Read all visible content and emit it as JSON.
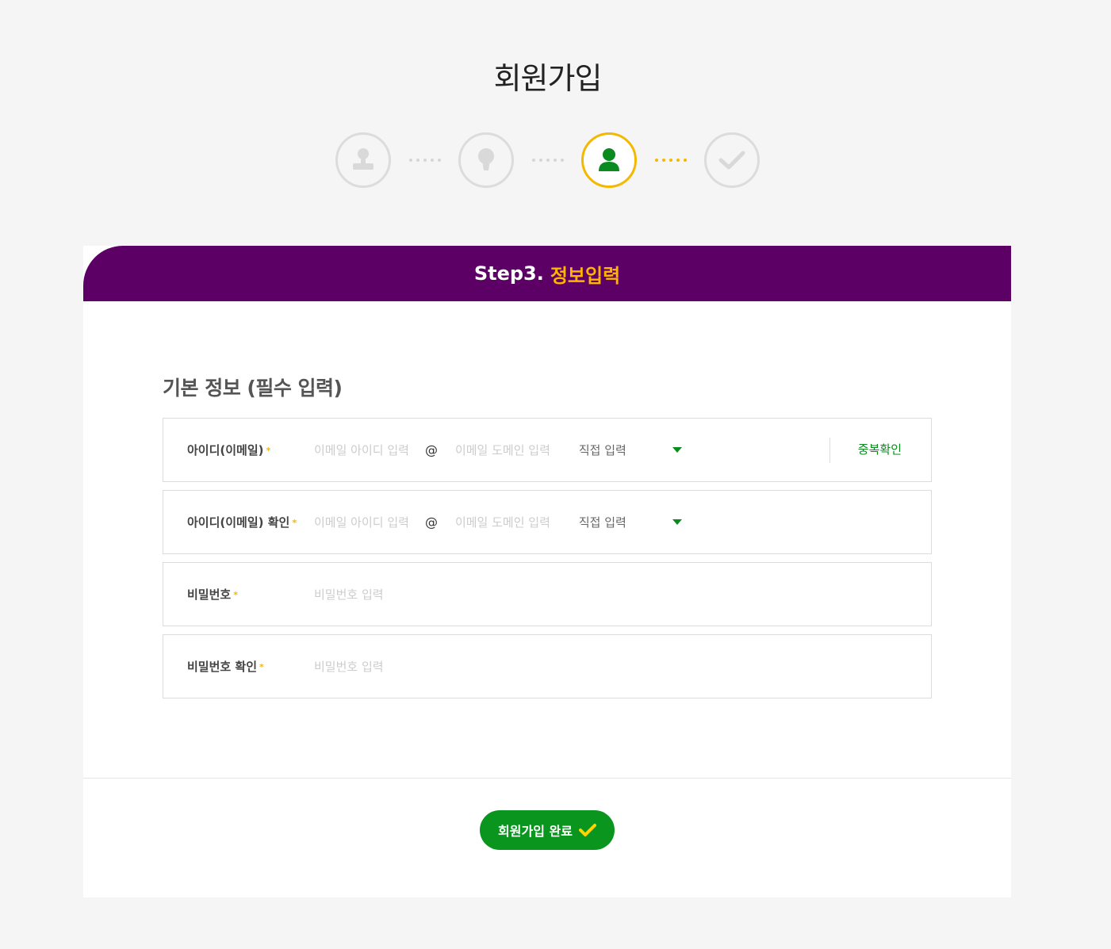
{
  "page": {
    "title": "회원가입"
  },
  "steps": [
    {
      "icon": "stamp-icon",
      "state": "inactive"
    },
    {
      "icon": "keyhole-icon",
      "state": "inactive"
    },
    {
      "icon": "user-icon",
      "state": "active"
    },
    {
      "icon": "check-icon",
      "state": "inactive"
    }
  ],
  "card": {
    "step_prefix": "Step3.",
    "step_title": "정보입력",
    "section_title": "기본 정보 (필수 입력)"
  },
  "form": {
    "required_mark": "*",
    "email": {
      "label": "아이디(이메일)",
      "id_placeholder": "이메일 아이디 입력",
      "at": "@",
      "domain_placeholder": "이메일 도메인 입력",
      "domain_select": "직접 입력",
      "dup_check": "중복확인"
    },
    "email_confirm": {
      "label": "아이디(이메일) 확인",
      "id_placeholder": "이메일 아이디 입력",
      "at": "@",
      "domain_placeholder": "이메일 도메인 입력",
      "domain_select": "직접 입력"
    },
    "password": {
      "label": "비밀번호",
      "placeholder": "비밀번호 입력"
    },
    "password_confirm": {
      "label": "비밀번호 확인",
      "placeholder": "비밀번호 입력"
    }
  },
  "submit": {
    "label": "회원가입 완료"
  },
  "colors": {
    "header_bg": "#5c0066",
    "accent_yellow": "#f5b800",
    "accent_green": "#0a961e"
  }
}
